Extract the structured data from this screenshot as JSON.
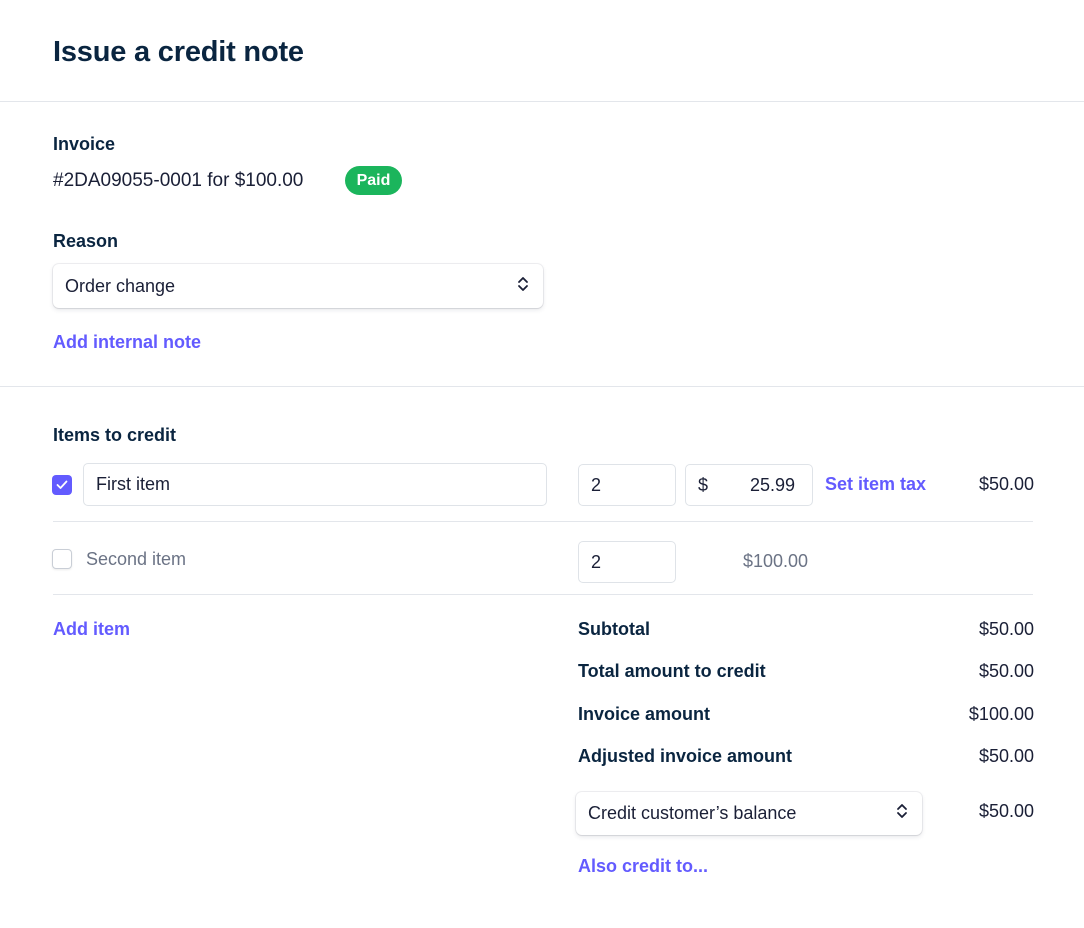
{
  "header": {
    "title": "Issue a credit note"
  },
  "invoice": {
    "label": "Invoice",
    "summary": "#2DA09055-0001 for $100.00",
    "status": "Paid",
    "status_color": "#1bb55c"
  },
  "reason": {
    "label": "Reason",
    "selected": "Order change",
    "add_note_link": "Add internal note"
  },
  "items": {
    "label": "Items to credit",
    "rows": [
      {
        "checked": true,
        "name": "First item",
        "quantity": "2",
        "currency": "$",
        "unit_price": "25.99",
        "tax_link": "Set item tax",
        "amount": "$50.00"
      },
      {
        "checked": false,
        "name": "Second item",
        "quantity": "2",
        "amount": "$100.00"
      }
    ],
    "add_item_link": "Add item"
  },
  "summary": {
    "subtotal_label": "Subtotal",
    "subtotal": "$50.00",
    "total_label": "Total amount to credit",
    "total": "$50.00",
    "invoice_amount_label": "Invoice amount",
    "invoice_amount": "$100.00",
    "adjusted_label": "Adjusted invoice amount",
    "adjusted": "$50.00",
    "credit_method": "Credit customer’s balance",
    "credit_amount": "$50.00",
    "also_credit_link": "Also credit to..."
  },
  "colors": {
    "accent": "#635bff",
    "heading": "#0a2540",
    "divider": "#e3e6eb"
  }
}
